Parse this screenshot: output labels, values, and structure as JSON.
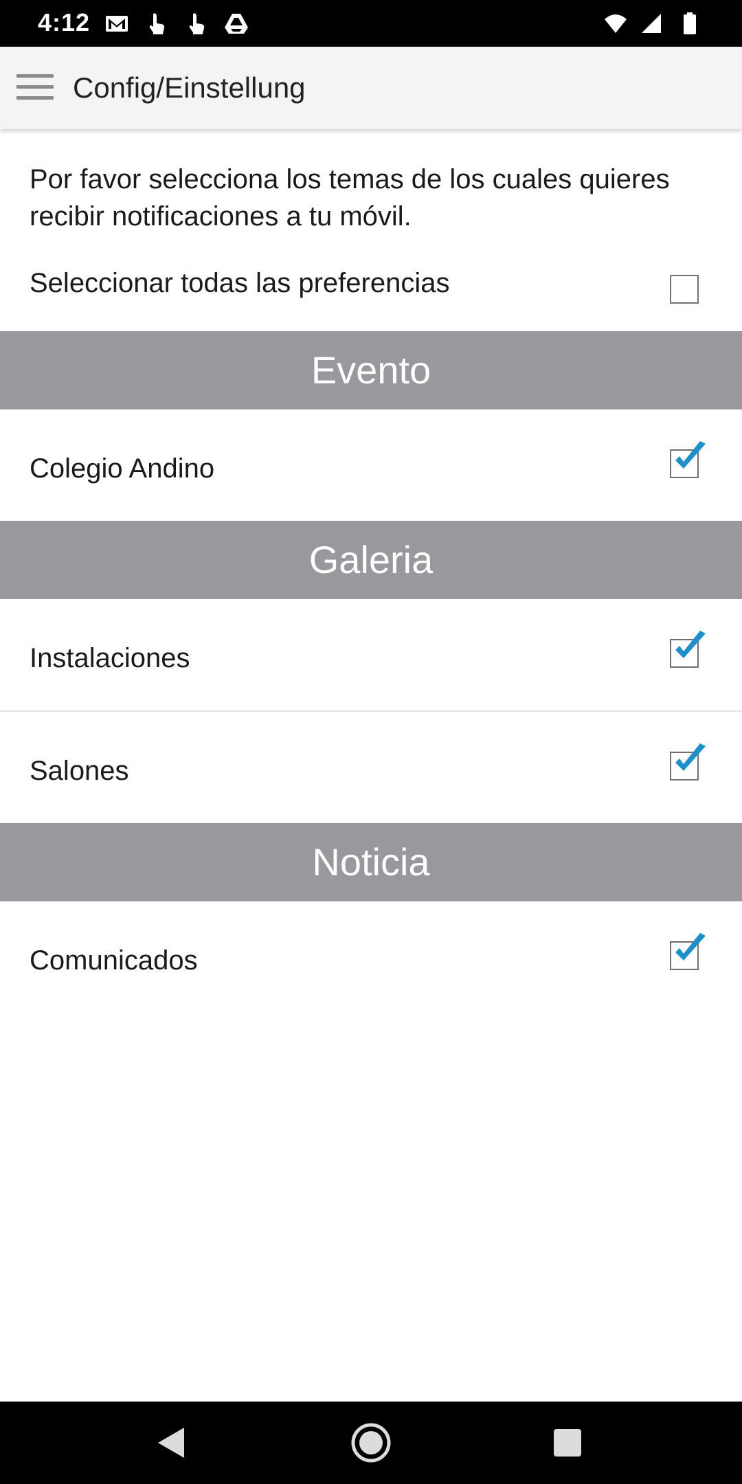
{
  "status_bar": {
    "time": "4:12",
    "left_icons": [
      "gmail-icon",
      "touch-icon",
      "touch-icon",
      "drive-icon"
    ],
    "right_icons": [
      "wifi-icon",
      "signal-icon",
      "battery-icon"
    ]
  },
  "app_bar": {
    "menu_icon": "hamburger-menu-icon",
    "title": "Config/Einstellung"
  },
  "intro_text": "Por favor selecciona los temas de los cuales quieres recibir notificaciones a tu móvil.",
  "select_all": {
    "label": "Seleccionar todas las preferencias",
    "checked": false
  },
  "sections": [
    {
      "title": "Evento",
      "items": [
        {
          "label": "Colegio Andino",
          "checked": true
        }
      ]
    },
    {
      "title": "Galeria",
      "items": [
        {
          "label": "Instalaciones",
          "checked": true
        },
        {
          "label": "Salones",
          "checked": true
        }
      ]
    },
    {
      "title": "Noticia",
      "items": [
        {
          "label": "Comunicados",
          "checked": true
        }
      ]
    }
  ],
  "colors": {
    "section_header_bg": "#98989d",
    "check_accent": "#1e8fc8",
    "app_bar_bg": "#f4f4f4"
  },
  "nav_bar": {
    "back_icon": "back-triangle-icon",
    "home_icon": "home-circle-icon",
    "recents_icon": "recents-square-icon"
  }
}
